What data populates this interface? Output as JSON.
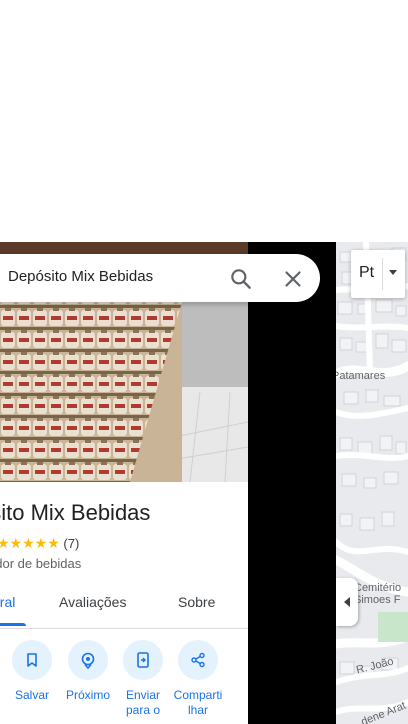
{
  "search": {
    "query": "Depósito Mix Bebidas"
  },
  "place": {
    "name": "ósito Mix Bebidas",
    "rating_stars": "★★★★★",
    "review_count": "(7)",
    "category": "edor de bebidas"
  },
  "tabs": [
    {
      "label": "eral",
      "active": true
    },
    {
      "label": "Avaliações",
      "active": false
    },
    {
      "label": "Sobre",
      "active": false
    }
  ],
  "actions": [
    {
      "label": "Salvar",
      "icon": "bookmark-icon"
    },
    {
      "label": "Próximo",
      "icon": "nearby-icon"
    },
    {
      "label": "Enviar para o",
      "icon": "send-to-phone-icon"
    },
    {
      "label": "Comparti lhar",
      "icon": "share-icon"
    }
  ],
  "map": {
    "layer_label": "Pt",
    "streets": [
      "Patamares",
      "Cemitério Simoes F",
      "R. João",
      "dene Arat"
    ]
  },
  "colors": {
    "accent": "#1a73e8",
    "action_bg": "#e3f2fd",
    "star": "#fbbc04"
  }
}
